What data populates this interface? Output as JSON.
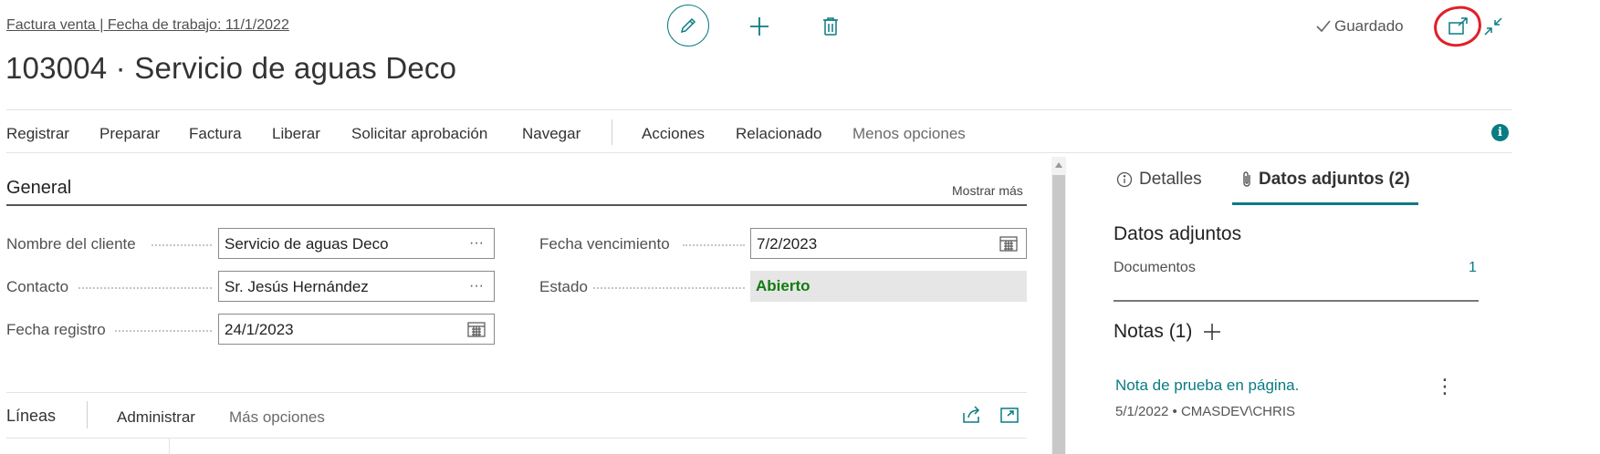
{
  "header": {
    "breadcrumb": "Factura venta | Fecha de trabajo: 11/1/2022",
    "title": "103004 · Servicio de aguas Deco",
    "saved_status": "Guardado",
    "icons": [
      "edit-icon",
      "plus-icon",
      "trash-icon",
      "checkmark-icon",
      "popout-icon",
      "collapse-icon"
    ]
  },
  "actions": {
    "items": [
      "Registrar",
      "Preparar",
      "Factura",
      "Liberar",
      "Solicitar aprobación",
      "Navegar",
      "Acciones",
      "Relacionado",
      "Menos opciones"
    ],
    "info_icon": "i"
  },
  "general": {
    "title": "General",
    "show_more": "Mostrar más",
    "fields": {
      "customer_name": {
        "label": "Nombre del cliente",
        "value": "Servicio de aguas Deco",
        "button": "···"
      },
      "contact": {
        "label": "Contacto",
        "value": "Sr. Jesús Hernández",
        "button": "···"
      },
      "posting_date": {
        "label": "Fecha registro",
        "value": "24/1/2023"
      },
      "due_date": {
        "label": "Fecha vencimiento",
        "value": "7/2/2023"
      },
      "status": {
        "label": "Estado",
        "value": "Abierto"
      }
    }
  },
  "lines": {
    "title": "Líneas",
    "manage": "Administrar",
    "more_options": "Más opciones"
  },
  "factbox": {
    "tabs": {
      "details": "Detalles",
      "attachments": "Datos adjuntos (2)"
    },
    "attachments_heading": "Datos adjuntos",
    "documents_label": "Documentos",
    "documents_count": "1",
    "notes_heading": "Notas (1)",
    "note": {
      "title": "Nota de prueba en página.",
      "meta": "5/1/2022 • CMASDEV\\CHRIS",
      "menu": "⋮"
    }
  },
  "colors": {
    "accent": "#0a7b83",
    "status_open": "#107c10",
    "annotation_circle": "#e0202a"
  }
}
